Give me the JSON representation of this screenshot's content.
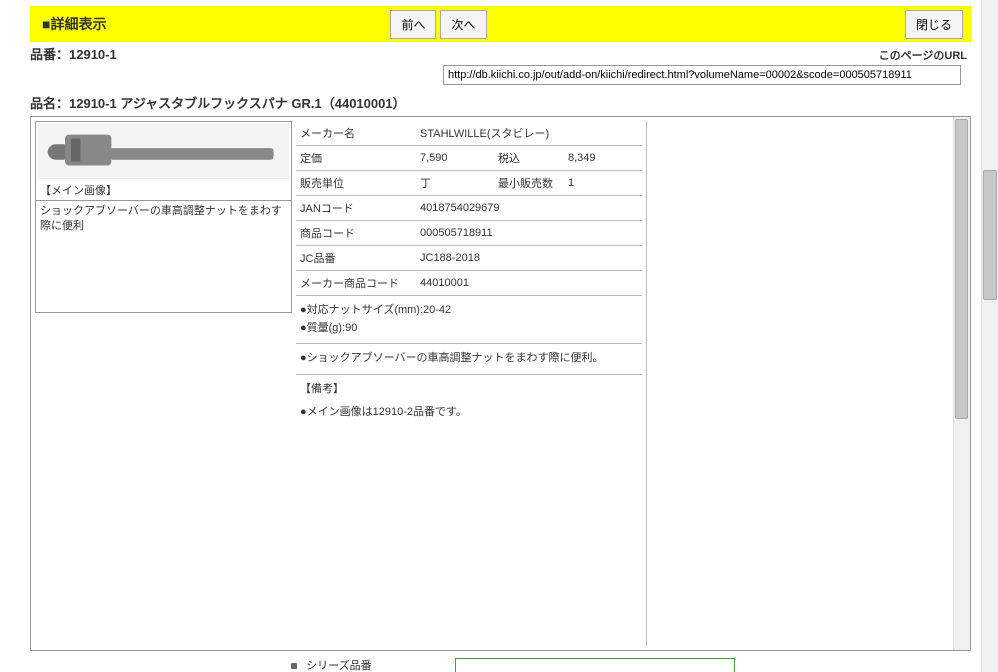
{
  "header": {
    "title": "■詳細表示",
    "prev_label": "前へ",
    "next_label": "次へ",
    "close_label": "閉じる"
  },
  "item_code_label": "品番：",
  "item_code": "12910-1",
  "url_section_label": "このページのURL",
  "page_url": "http://db.kiichi.co.jp/out/add-on/kiichi/redirect.html?volumeName=00002&scode=000505718911",
  "item_name_label": "品名：",
  "item_name": "12910-1 アジャスタブルフックスパナ GR.1（44010001）",
  "image_caption": "【メイン画像】",
  "short_desc": "ショックアブソーバーの車高調整ナットをまわす際に便利",
  "spec": {
    "maker_label": "メーカー名",
    "maker_value": "STAHLWILLE(スタビレー)",
    "price_label": "定価",
    "price_value": "7,590",
    "tax_label": "税込",
    "tax_value": "8,349",
    "unit_label": "販売単位",
    "unit_value": "丁",
    "minqty_label": "最小販売数",
    "minqty_value": "1",
    "jan_label": "JANコード",
    "jan_value": "4018754029679",
    "prodcode_label": "商品コード",
    "prodcode_value": "000505718911",
    "jc_label": "JC品番",
    "jc_value": "JC188-2018",
    "makerprod_label": "メーカー商品コード",
    "makerprod_value": "44010001"
  },
  "bullets": {
    "b1": "●対応ナットサイズ(mm):20-42",
    "b2": "●質量(g):90",
    "b3": "●ショックアブソーバーの車高調整ナットをまわす際に便利。",
    "remarks_label": "【備考】",
    "b4": "●メイン画像は12910-2品番です。"
  },
  "series_label": "シリーズ品番"
}
